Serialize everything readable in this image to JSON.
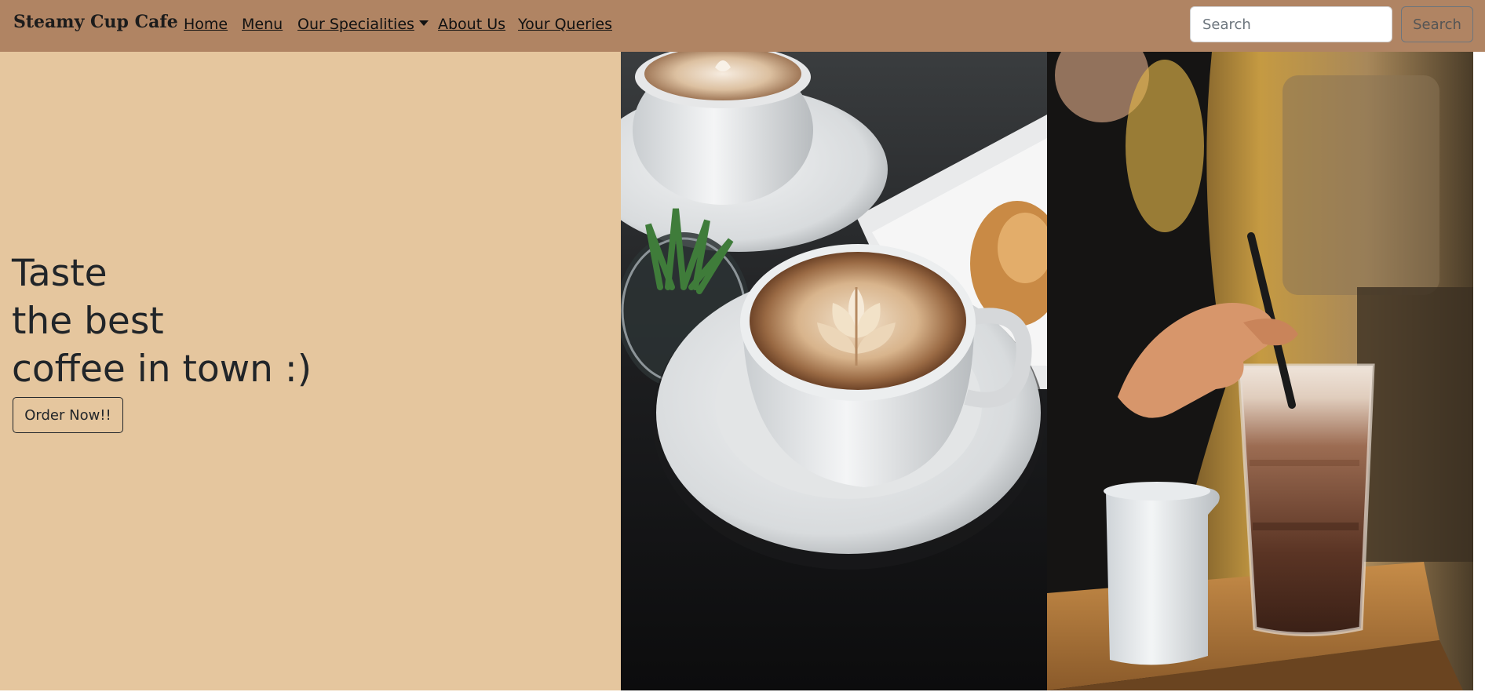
{
  "navbar": {
    "brand": "Steamy Cup Cafe",
    "links": [
      {
        "label": "Home"
      },
      {
        "label": "Menu"
      },
      {
        "label": "Our Specialities"
      },
      {
        "label": "About Us"
      },
      {
        "label": "Your Queries"
      }
    ],
    "search": {
      "placeholder": "Search",
      "value": "",
      "button_label": "Search"
    },
    "background_color": "#b08463"
  },
  "hero": {
    "title_lines": [
      "Taste",
      "the best",
      "coffee in town :)"
    ],
    "button_label": "Order Now!!",
    "background_color": "#e5c69e"
  },
  "images": [
    {
      "name": "latte-art-cup-photo"
    },
    {
      "name": "iced-mocha-photo"
    }
  ]
}
